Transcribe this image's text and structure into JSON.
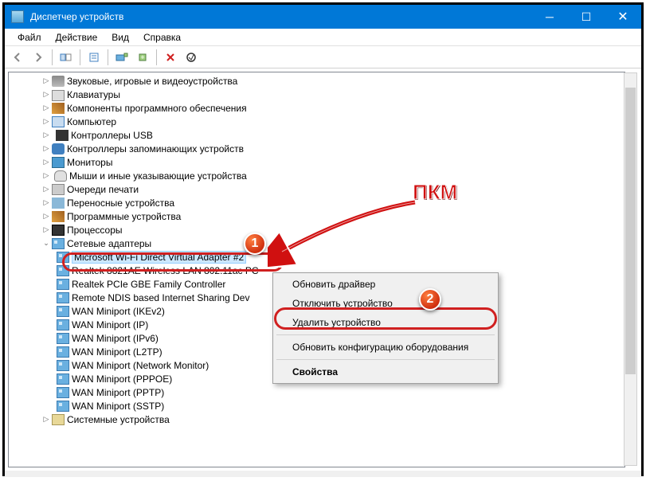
{
  "window": {
    "title": "Диспетчер устройств"
  },
  "menu": {
    "file": "Файл",
    "action": "Действие",
    "view": "Вид",
    "help": "Справка"
  },
  "tree": {
    "audio": "Звуковые, игровые и видеоустройства",
    "keyboards": "Клавиатуры",
    "software": "Компоненты программного обеспечения",
    "computer": "Компьютер",
    "usb": "Контроллеры USB",
    "storage": "Контроллеры запоминающих устройств",
    "monitors": "Мониторы",
    "mice": "Мыши и иные указывающие устройства",
    "printq": "Очереди печати",
    "portable": "Переносные устройства",
    "swdev": "Программные устройства",
    "cpu": "Процессоры",
    "netadapters": "Сетевые адаптеры",
    "net": {
      "wifi_direct": "Microsoft Wi-Fi Direct Virtual Adapter #2",
      "realtek_wlan": "Realtek 8821AE Wireless LAN 802.11ac PC",
      "realtek_gbe": "Realtek PCIe GBE Family Controller",
      "rndis": "Remote NDIS based Internet Sharing Dev",
      "wan_ikev2": "WAN Miniport (IKEv2)",
      "wan_ip": "WAN Miniport (IP)",
      "wan_ipv6": "WAN Miniport (IPv6)",
      "wan_l2tp": "WAN Miniport (L2TP)",
      "wan_netmon": "WAN Miniport (Network Monitor)",
      "wan_pppoe": "WAN Miniport (PPPOE)",
      "wan_pptp": "WAN Miniport (PPTP)",
      "wan_sstp": "WAN Miniport (SSTP)"
    },
    "system": "Системные устройства"
  },
  "context_menu": {
    "update_driver": "Обновить драйвер",
    "disable": "Отключить устройство",
    "uninstall": "Удалить устройство",
    "scan": "Обновить конфигурацию оборудования",
    "properties": "Свойства"
  },
  "annotations": {
    "pkm": "ПКМ",
    "badge1": "1",
    "badge2": "2"
  }
}
